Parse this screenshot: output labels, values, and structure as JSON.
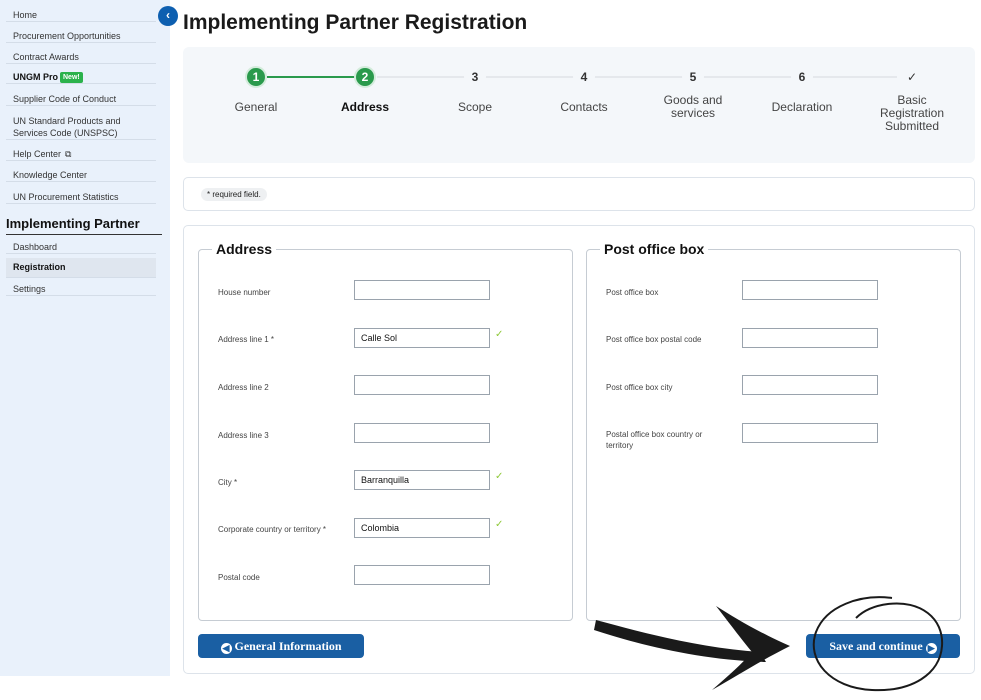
{
  "sidebar": {
    "links": [
      {
        "label": "Home"
      },
      {
        "label": "Procurement Opportunities"
      },
      {
        "label": "Contract Awards"
      },
      {
        "label": "UNGM Pro",
        "badge": "New!"
      },
      {
        "label": "Supplier Code of Conduct"
      },
      {
        "label": "UN Standard Products and",
        "label2": "Services Code (UNSPSC)"
      },
      {
        "label": "Help Center"
      },
      {
        "label": "Knowledge Center"
      },
      {
        "label": "UN Procurement Statistics"
      }
    ],
    "section_title": "Implementing Partner",
    "section_links": [
      {
        "label": "Dashboard"
      },
      {
        "label": "Registration"
      },
      {
        "label": "Settings"
      }
    ],
    "collapse_glyph": "‹"
  },
  "page": {
    "title": "Implementing Partner Registration"
  },
  "stepper": {
    "steps": [
      {
        "number": "1",
        "label": "General"
      },
      {
        "number": "2",
        "label": "Address"
      },
      {
        "number": "3",
        "label": "Scope"
      },
      {
        "number": "4",
        "label": "Contacts"
      },
      {
        "number": "5",
        "label": "Goods and",
        "label2": "services"
      },
      {
        "number": "6",
        "label": "Declaration"
      },
      {
        "number": "✓",
        "label": "Basic",
        "label2": "Registration",
        "label3": "Submitted"
      }
    ]
  },
  "required_note": "* required field.",
  "address": {
    "legend": "Address",
    "fields": [
      {
        "label": "House number",
        "value": ""
      },
      {
        "label": "Address line 1 *",
        "value": "Calle Sol"
      },
      {
        "label": "Address line 2",
        "value": ""
      },
      {
        "label": "Address line 3",
        "value": ""
      },
      {
        "label": "City *",
        "value": "Barranquilla"
      },
      {
        "label": "Corporate country or territory *",
        "value": "Colombia"
      },
      {
        "label": "Postal code",
        "value": ""
      }
    ]
  },
  "pobox": {
    "legend": "Post office box",
    "fields": [
      {
        "label": "Post office box",
        "value": ""
      },
      {
        "label": "Post office box postal code",
        "value": ""
      },
      {
        "label": "Post office box city",
        "value": ""
      },
      {
        "label": "Postal office box country or",
        "label2": "territory",
        "value": ""
      }
    ]
  },
  "buttons": {
    "back": "General Information",
    "next": "Save and continue"
  },
  "colors": {
    "accent": "#1a5fa3",
    "done": "#2a9a4c",
    "valid": "#8fc93a"
  }
}
